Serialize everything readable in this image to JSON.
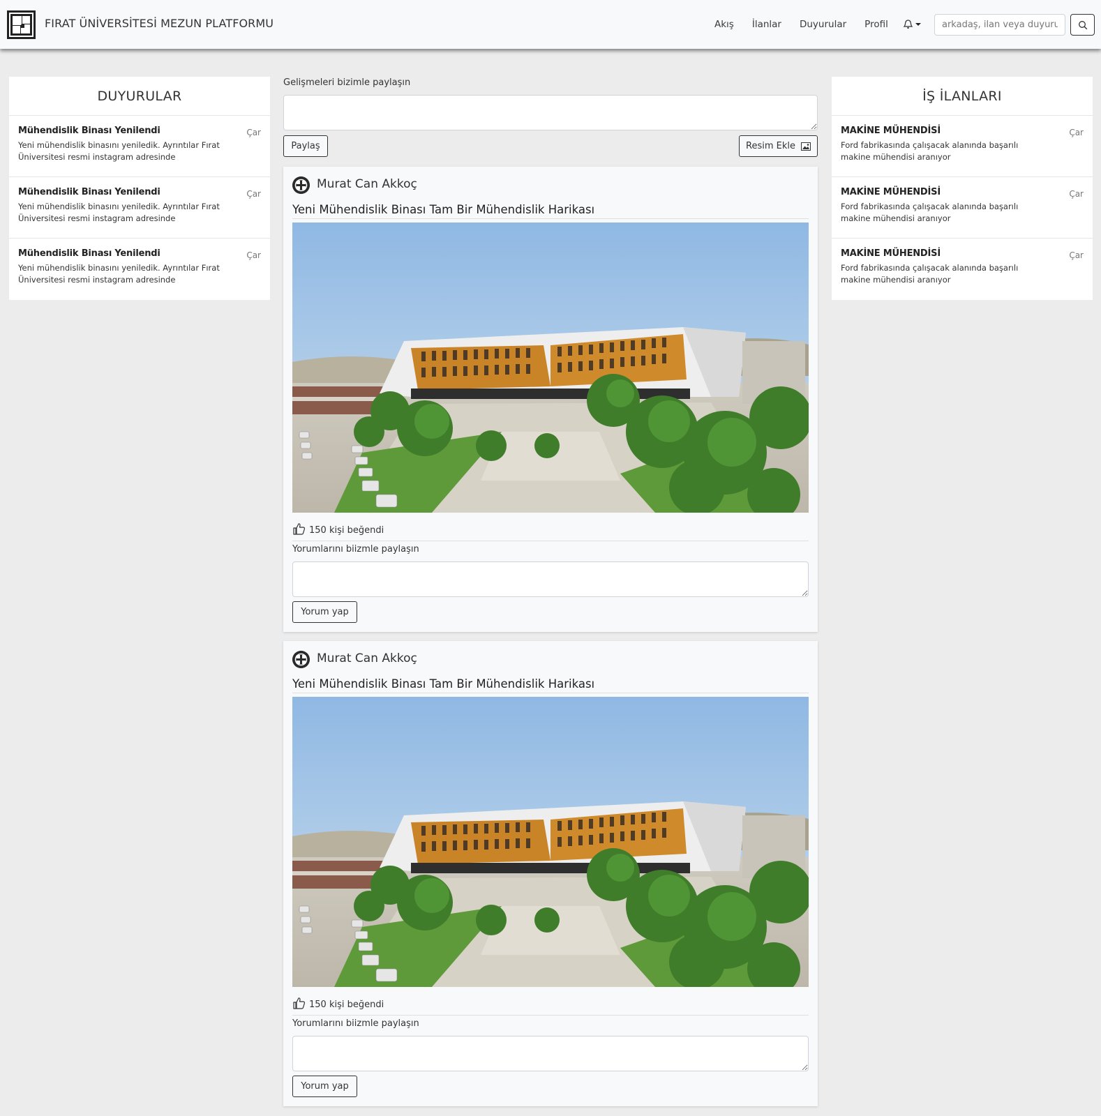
{
  "navbar": {
    "brand": "FIRAT ÜNİVERSİTESİ MEZUN PLATFORMU",
    "links": [
      "Akış",
      "İlanlar",
      "Duyurular",
      "Profil"
    ],
    "search_placeholder": "arkadaş, ilan veya duyuru"
  },
  "announcements": {
    "title": "DUYURULAR",
    "items": [
      {
        "title": "Mühendislik Binası Yenilendi",
        "day": "Çar",
        "text": "Yeni mühendislik binasını yeniledik. Ayrıntılar Fırat Üniversitesi resmi instagram adresinde"
      },
      {
        "title": "Mühendislik Binası Yenilendi",
        "day": "Çar",
        "text": "Yeni mühendislik binasını yeniledik. Ayrıntılar Fırat Üniversitesi resmi instagram adresinde"
      },
      {
        "title": "Mühendislik Binası Yenilendi",
        "day": "Çar",
        "text": "Yeni mühendislik binasını yeniledik. Ayrıntılar Fırat Üniversitesi resmi instagram adresinde"
      }
    ]
  },
  "jobs": {
    "title": "İŞ İLANLARI",
    "items": [
      {
        "title": "MAKİNE MÜHENDİSİ",
        "day": "Çar",
        "text": "Ford fabrikasında çalışacak alanında başarılı makine mühendisi aranıyor"
      },
      {
        "title": "MAKİNE MÜHENDİSİ",
        "day": "Çar",
        "text": "Ford fabrikasında çalışacak alanında başarılı makine mühendisi aranıyor"
      },
      {
        "title": "MAKİNE MÜHENDİSİ",
        "day": "Çar",
        "text": "Ford fabrikasında çalışacak alanında başarılı makine mühendisi aranıyor"
      }
    ]
  },
  "composer": {
    "label": "Gelişmeleri bizimle paylaşın",
    "share_button": "Paylaş",
    "add_image_button": "Resim Ekle"
  },
  "posts": [
    {
      "author": "Murat Can Akkoç",
      "title": "Yeni Mühendislik Binası Tam Bir Mühendislik Harikası",
      "likes": "150 kişi beğendi",
      "comment_label": "Yorumlarını biizmle paylaşın",
      "comment_button": "Yorum yap"
    },
    {
      "author": "Murat Can Akkoç",
      "title": "Yeni Mühendislik Binası Tam Bir Mühendislik Harikası",
      "likes": "150 kişi beğendi",
      "comment_label": "Yorumlarını biizmle paylaşın",
      "comment_button": "Yorum yap"
    }
  ]
}
